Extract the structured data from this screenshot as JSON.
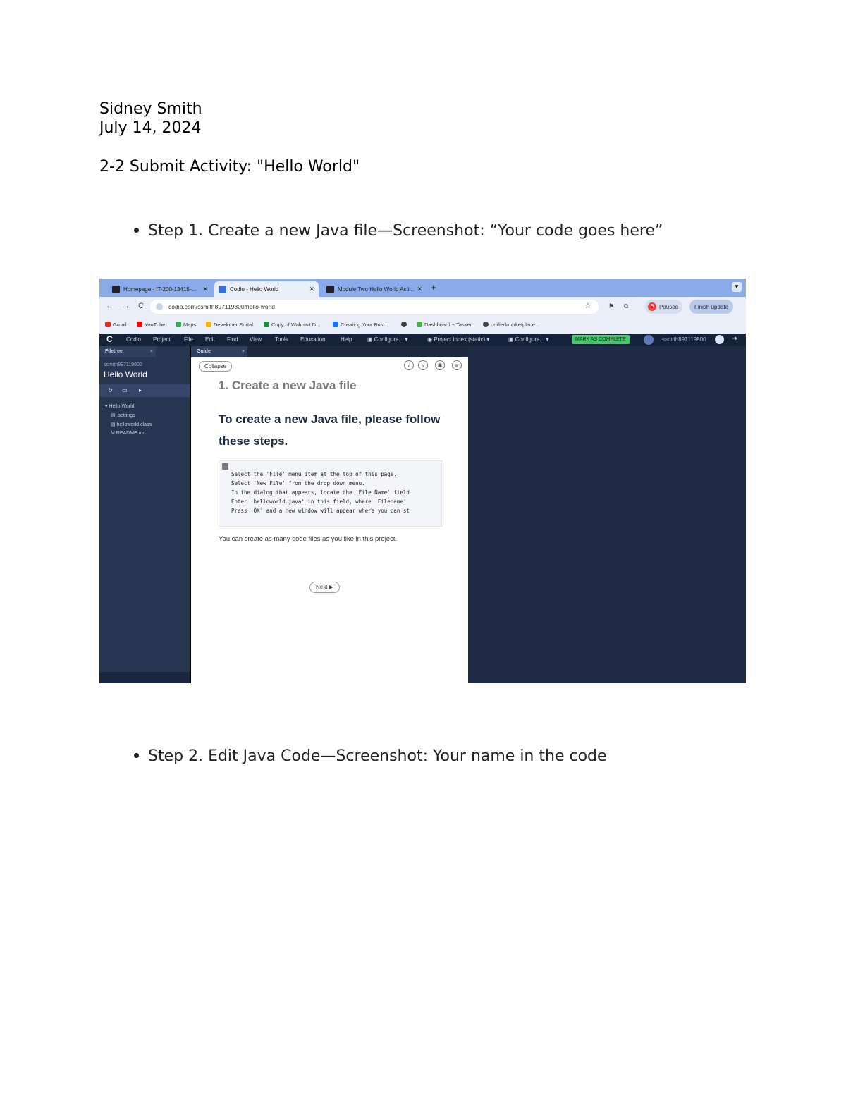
{
  "doc": {
    "author": "Sidney Smith",
    "date": "July 14, 2024",
    "title": "2-2 Submit Activity: \"Hello World\"",
    "step1": "Step 1. Create a new Java file—Screenshot: “Your code goes here”",
    "step2": "Step 2. Edit Java Code—Screenshot: Your name in the code"
  },
  "browser": {
    "tabs": [
      {
        "label": "Homepage - IT-200-13415-..."
      },
      {
        "label": "Codio - Hello World"
      },
      {
        "label": "Module Two Hello World Acti..."
      }
    ],
    "new_tab": "+",
    "url": "codio.com/ssmith897119800/hello-world",
    "profile_initial": "S",
    "paused": "Paused",
    "finish_update": "Finish update",
    "bookmarks": [
      "Gmail",
      "YouTube",
      "Maps",
      "Developer Portal",
      "Copy of Walmart D...",
      "Creating Your Busi...",
      "Dashboard ~ Tasker",
      "unifiedmarketplace..."
    ]
  },
  "codio": {
    "logo": "C",
    "menu": [
      "Codio",
      "Project",
      "File",
      "Edit",
      "Find",
      "View",
      "Tools",
      "Education",
      "Help"
    ],
    "dropdowns": [
      "Configure...",
      "Project Index (static)",
      "Configure..."
    ],
    "mark_complete": "MARK AS COMPLETE",
    "user": "ssmith897119800",
    "filetree": {
      "tab": "Filetree",
      "close": "×",
      "user": "ssmith897119800",
      "project": "Hello World",
      "items": [
        "Hello World",
        ".settings",
        "helloworld.class",
        "README.md"
      ]
    },
    "guide": {
      "tab": "Guide",
      "close": "×",
      "collapse": "Collapse",
      "heading": "1. Create a new Java file",
      "subheading": "To create a new Java file, please follow these steps.",
      "code_lines": [
        "Select the 'File' menu item at the top of this page.",
        "Select 'New File' from the drop down menu.",
        "In the dialog that appears, locate the 'File Name' field",
        "Enter 'helloworld.java' in this field, where 'Filename'",
        "Press 'OK' and a new window will appear where you can st"
      ],
      "note": "You can create as many code files as you like in this project.",
      "next": "Next ▶"
    }
  }
}
